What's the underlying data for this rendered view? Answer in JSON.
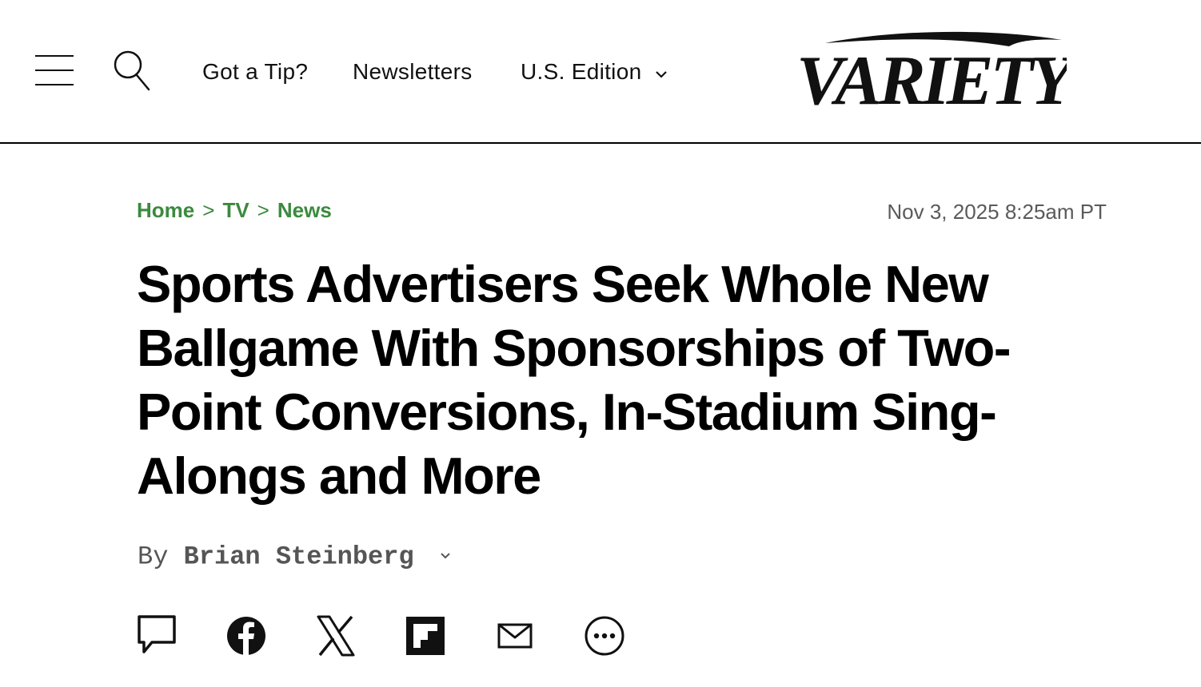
{
  "header": {
    "nav": {
      "tip_label": "Got a Tip?",
      "newsletters_label": "Newsletters",
      "edition_label": "U.S. Edition"
    },
    "logo_text": "VARIETY",
    "icons": [
      "menu-icon",
      "search-icon",
      "chevron-down-icon"
    ]
  },
  "article": {
    "breadcrumb": [
      {
        "label": "Home"
      },
      {
        "label": "TV"
      },
      {
        "label": "News"
      }
    ],
    "breadcrumb_separator": ">",
    "timestamp": "Nov 3, 2025 8:25am PT",
    "headline": "Sports Advertisers Seek Whole New Ballgame With Sponsorships of Two-Point Conversions, In-Stadium Sing-Alongs and More",
    "byline_prefix": "By",
    "author": "Brian Steinberg"
  },
  "share": {
    "icons": [
      "comment-icon",
      "facebook-icon",
      "x-icon",
      "flipboard-icon",
      "email-icon",
      "more-icon"
    ]
  },
  "colors": {
    "breadcrumb": "#3b8a3e",
    "timestamp": "#5a5a5a",
    "byline": "#555555",
    "header_border": "#000000"
  }
}
